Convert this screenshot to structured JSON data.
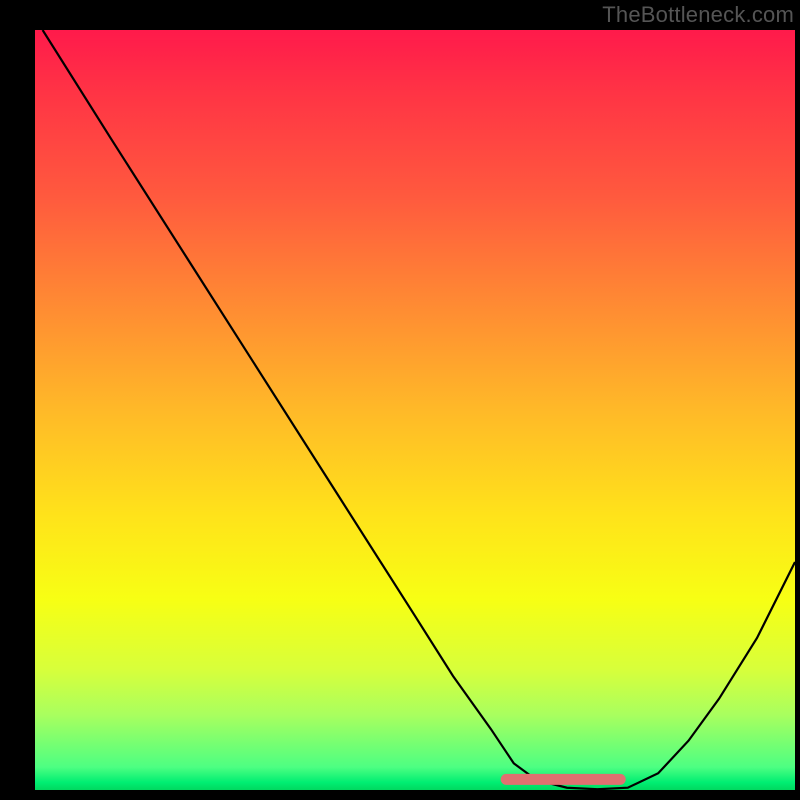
{
  "watermark": "TheBottleneck.com",
  "chart_data": {
    "type": "line",
    "title": "",
    "xlabel": "",
    "ylabel": "",
    "xlim": [
      0,
      100
    ],
    "ylim": [
      0,
      100
    ],
    "grid": false,
    "legend": false,
    "gradient_stops": [
      {
        "pct": 0,
        "color": "#ff1a4b"
      },
      {
        "pct": 8,
        "color": "#ff3345"
      },
      {
        "pct": 22,
        "color": "#ff5a3e"
      },
      {
        "pct": 36,
        "color": "#ff8a33"
      },
      {
        "pct": 50,
        "color": "#ffb928"
      },
      {
        "pct": 64,
        "color": "#ffe31a"
      },
      {
        "pct": 75,
        "color": "#f7ff14"
      },
      {
        "pct": 84,
        "color": "#d8ff3a"
      },
      {
        "pct": 90,
        "color": "#aaff5e"
      },
      {
        "pct": 97,
        "color": "#4dff82"
      },
      {
        "pct": 99,
        "color": "#00ee72"
      },
      {
        "pct": 100,
        "color": "#00d85f"
      }
    ],
    "series": [
      {
        "name": "bottleneck-curve",
        "color": "#000000",
        "stroke_width": 2.2,
        "x": [
          1,
          10,
          20,
          30,
          40,
          50,
          55,
          60,
          63,
          66,
          70,
          74,
          78,
          82,
          86,
          90,
          95,
          100
        ],
        "y": [
          100,
          85.7,
          70,
          54.3,
          38.6,
          22.9,
          15,
          8,
          3.5,
          1.3,
          0.3,
          0.1,
          0.3,
          2.2,
          6.5,
          12,
          20,
          30
        ]
      },
      {
        "name": "target-flat-segment",
        "color": "#e07070",
        "stroke_width": 11,
        "linecap": "round",
        "x": [
          62,
          77
        ],
        "y": [
          1.4,
          1.4
        ]
      }
    ]
  }
}
